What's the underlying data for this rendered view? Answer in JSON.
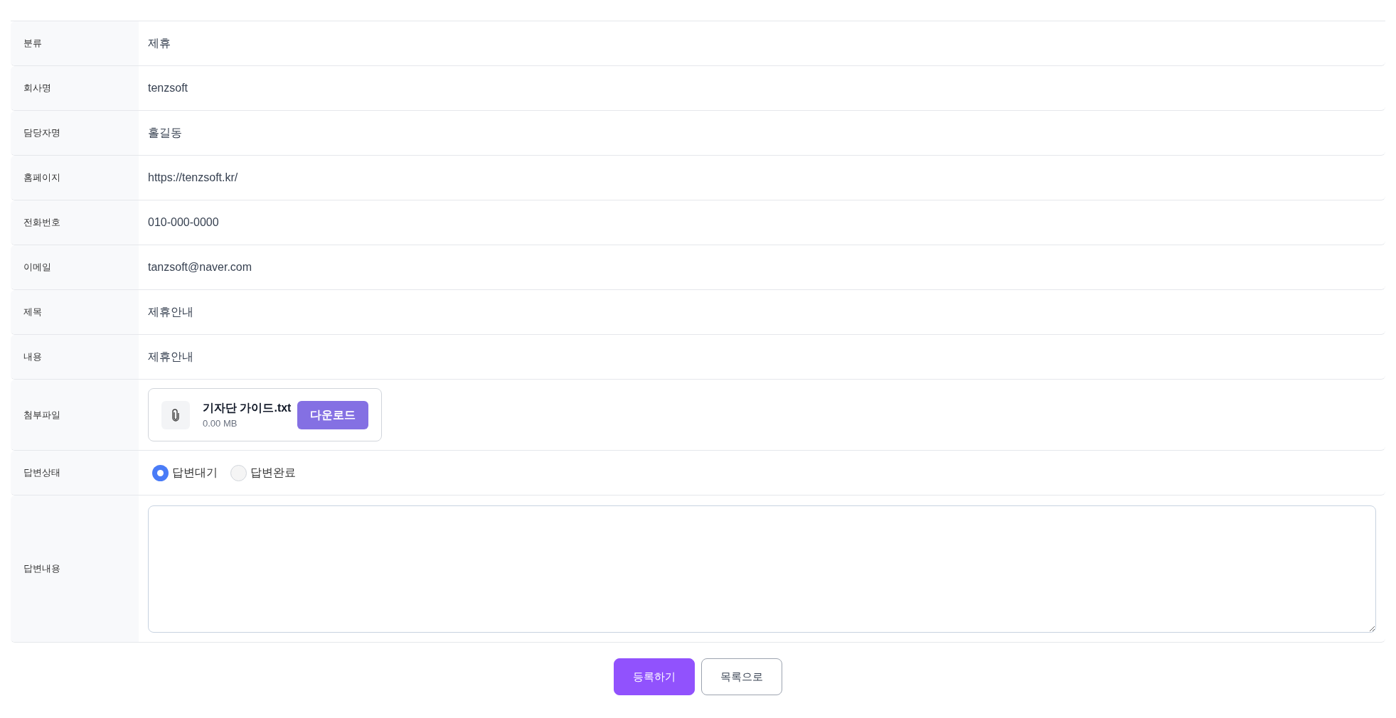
{
  "rows": [
    {
      "kind": "text",
      "label": "분류",
      "value": "제휴"
    },
    {
      "kind": "text",
      "label": "회사명",
      "value": "tenzsoft"
    },
    {
      "kind": "text",
      "label": "담당자명",
      "value": "홀길동"
    },
    {
      "kind": "text",
      "label": "홈페이지",
      "value": "https://tenzsoft.kr/"
    },
    {
      "kind": "text",
      "label": "전화번호",
      "value": "010-000-0000"
    },
    {
      "kind": "text",
      "label": "이메일",
      "value": "tanzsoft@naver.com"
    },
    {
      "kind": "text",
      "label": "제목",
      "value": "제휴안내"
    },
    {
      "kind": "text",
      "label": "내용",
      "value": "제휴안내"
    },
    {
      "kind": "file",
      "label": "첨부파일",
      "file_name": "기자단 가이드.txt",
      "file_size": "0.00 MB",
      "button": "다운로드"
    },
    {
      "kind": "radio",
      "label": "답변상태",
      "options": [
        {
          "label": "답변대기",
          "selected": true
        },
        {
          "label": "답변완료",
          "selected": false
        }
      ]
    },
    {
      "kind": "textarea",
      "label": "답변내용"
    }
  ],
  "buttons": [
    {
      "kind": "primary",
      "label": "등록하기"
    },
    {
      "kind": "secondary",
      "label": "목록으로"
    }
  ]
}
